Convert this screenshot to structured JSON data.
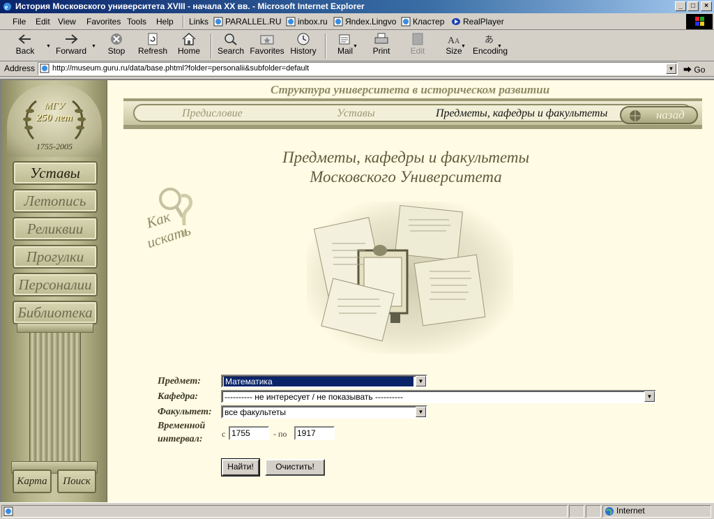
{
  "window": {
    "title": "История Московского университета XVIII - начала XX вв. - Microsoft Internet Explorer"
  },
  "menu": {
    "file": "File",
    "edit": "Edit",
    "view": "View",
    "favorites": "Favorites",
    "tools": "Tools",
    "help": "Help"
  },
  "links": {
    "label": "Links",
    "items": [
      "PARALLEL.RU",
      "inbox.ru",
      "Яndex.Lingvo",
      "Кластер",
      "RealPlayer"
    ]
  },
  "toolbar": {
    "back": "Back",
    "forward": "Forward",
    "stop": "Stop",
    "refresh": "Refresh",
    "home": "Home",
    "search": "Search",
    "favorites": "Favorites",
    "history": "History",
    "mail": "Mail",
    "print": "Print",
    "edit": "Edit",
    "size": "Size",
    "encoding": "Encoding"
  },
  "address": {
    "label": "Address",
    "url": "http://museum.guru.ru/data/base.phtml?folder=personalii&subfolder=default",
    "go": "Go"
  },
  "sidebar": {
    "medal": {
      "line1": "МГУ",
      "line2": "250 лет",
      "line3": "1755-2005"
    },
    "nav": [
      "Уставы",
      "Летопись",
      "Реликвии",
      "Прогулки",
      "Персоналии",
      "Библиотека"
    ],
    "bottom": [
      "Карта",
      "Поиск"
    ]
  },
  "header": {
    "title": "Структура университета в историческом развитии",
    "nav": [
      "Предисловие",
      "Уставы",
      "Предметы, кафедры и факультеты"
    ],
    "back": "назад"
  },
  "page": {
    "title_line1": "Предметы, кафедры и факультеты",
    "title_line2": "Московского Университета",
    "how_search_line1": "Как",
    "how_search_line2": "искать"
  },
  "form": {
    "subject_label": "Предмет:",
    "subject_value": "Математика",
    "chair_label": "Кафедра:",
    "chair_value": "---------- не интересует / не показывать ----------",
    "faculty_label": "Факультет:",
    "faculty_value": "все факультеты",
    "interval_label_1": "Временной",
    "interval_label_2": "интервал:",
    "from_prefix": "с",
    "from_value": "1755",
    "to_prefix": "- по",
    "to_value": "1917",
    "find_button": "Найти!",
    "clear_button": "Очистить!"
  },
  "status": {
    "zone": "Internet"
  },
  "colors": {
    "title_bar": "#0a246a",
    "page_bg": "#fffbe4",
    "olive": "#8a8860",
    "highlight": "#0a246a"
  }
}
